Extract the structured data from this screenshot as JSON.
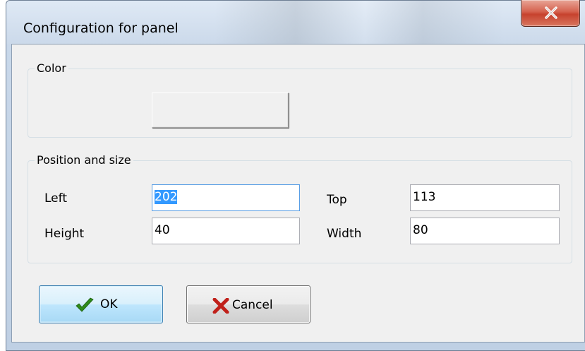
{
  "window": {
    "title": "Configuration for panel"
  },
  "titlebar": {
    "close_icon": "close-x-icon"
  },
  "color_group": {
    "label": "Color",
    "swatch_color": "#f0f0f0"
  },
  "position_group": {
    "label": "Position and size",
    "left": {
      "label": "Left",
      "value": "202"
    },
    "top": {
      "label": "Top",
      "value": "113"
    },
    "height": {
      "label": "Height",
      "value": "40"
    },
    "width": {
      "label": "Width",
      "value": "80"
    }
  },
  "buttons": {
    "ok": {
      "label": "OK",
      "icon": "checkmark-icon",
      "icon_color": "#2e8b1a"
    },
    "cancel": {
      "label": "Cancel",
      "icon": "red-x-icon",
      "icon_color": "#c0201a"
    }
  }
}
